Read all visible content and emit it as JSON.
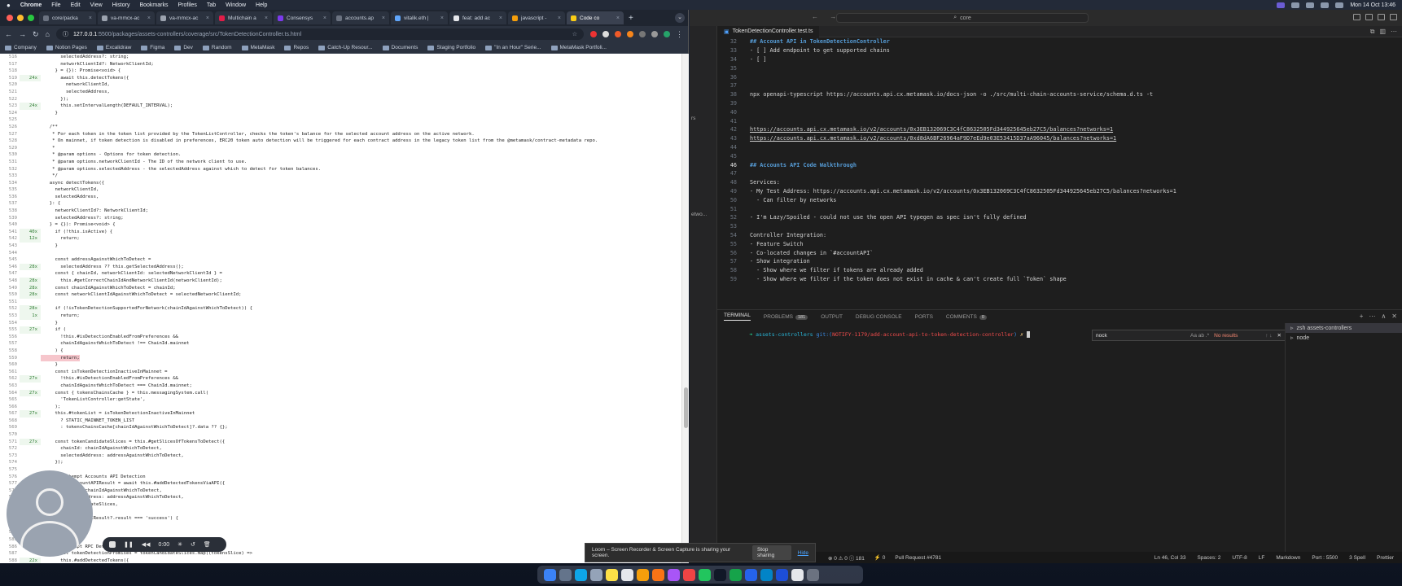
{
  "menubar": {
    "app": "Chrome",
    "items": [
      "File",
      "Edit",
      "View",
      "History",
      "Bookmarks",
      "Profiles",
      "Tab",
      "Window",
      "Help"
    ],
    "clock": "Mon 14 Oct 13:46"
  },
  "browser": {
    "tabs": [
      {
        "label": "core/packa",
        "color": "#6b7280"
      },
      {
        "label": "va-mmcx-ac",
        "color": "#9ca3af"
      },
      {
        "label": "va-mmcx-ac",
        "color": "#9ca3af"
      },
      {
        "label": "Multichain a",
        "color": "#e11d48"
      },
      {
        "label": "Consensys",
        "color": "#7c3aed"
      },
      {
        "label": "accounts.ap",
        "color": "#6b7280"
      },
      {
        "label": "vitalik.eth |",
        "color": "#60a5fa"
      },
      {
        "label": "feat: add ac",
        "color": "#e5e7eb"
      },
      {
        "label": "javascript -",
        "color": "#f59e0b"
      },
      {
        "label": "Code co",
        "color": "#facc15"
      }
    ],
    "new_tab": "+",
    "url_host": "127.0.0.1",
    "url_path": ":5500/packages/assets-controllers/coverage/src/TokenDetectionController.ts.html",
    "bookmarks": [
      "Company",
      "Notion Pages",
      "Excalidraw",
      "Figma",
      "Dev",
      "Random",
      "MetaMask",
      "Repos",
      "Catch-Up Resour...",
      "Documents",
      "Staging Portfolio",
      "\"In an Hour\" Serie...",
      "MetaMask Portfoli..."
    ]
  },
  "coverage": {
    "lines": [
      {
        "n": "516",
        "h": "",
        "t": "      selectedAddress?: string;"
      },
      {
        "n": "517",
        "h": "",
        "t": "      networkClientId?: NetworkClientId;"
      },
      {
        "n": "518",
        "h": "",
        "t": "    } = {}): Promise<void> {"
      },
      {
        "n": "519",
        "h": "24x",
        "t": "      await this.detectTokens({"
      },
      {
        "n": "520",
        "h": "",
        "t": "        networkClientId,"
      },
      {
        "n": "521",
        "h": "",
        "t": "        selectedAddress,"
      },
      {
        "n": "522",
        "h": "",
        "t": "      });"
      },
      {
        "n": "523",
        "h": "24x",
        "t": "      this.setIntervalLength(DEFAULT_INTERVAL);"
      },
      {
        "n": "524",
        "h": "",
        "t": "    }"
      },
      {
        "n": "525",
        "h": "",
        "t": ""
      },
      {
        "n": "526",
        "h": "",
        "t": "  /**"
      },
      {
        "n": "527",
        "h": "",
        "t": "   * For each token in the token list provided by the TokenListController, checks the token's balance for the selected account address on the active network."
      },
      {
        "n": "528",
        "h": "",
        "t": "   * On mainnet, if token detection is disabled in preferences, ERC20 token auto detection will be triggered for each contract address in the legacy token list from the @metamask/contract-metadata repo."
      },
      {
        "n": "529",
        "h": "",
        "t": "   *"
      },
      {
        "n": "530",
        "h": "",
        "t": "   * @param options - Options for token detection."
      },
      {
        "n": "531",
        "h": "",
        "t": "   * @param options.networkClientId - The ID of the network client to use."
      },
      {
        "n": "532",
        "h": "",
        "t": "   * @param options.selectedAddress - the selectedAddress against which to detect for token balances."
      },
      {
        "n": "533",
        "h": "",
        "t": "   */"
      },
      {
        "n": "534",
        "h": "",
        "t": "  async detectTokens({"
      },
      {
        "n": "535",
        "h": "",
        "t": "    networkClientId,"
      },
      {
        "n": "536",
        "h": "",
        "t": "    selectedAddress,"
      },
      {
        "n": "537",
        "h": "",
        "t": "  }: {"
      },
      {
        "n": "538",
        "h": "",
        "t": "    networkClientId?: NetworkClientId;"
      },
      {
        "n": "539",
        "h": "",
        "t": "    selectedAddress?: string;"
      },
      {
        "n": "540",
        "h": "",
        "t": "  } = {}): Promise<void> {"
      },
      {
        "n": "541",
        "h": "40x",
        "t": "    if (!this.isActive) {"
      },
      {
        "n": "542",
        "h": "12x",
        "t": "      return;"
      },
      {
        "n": "543",
        "h": "",
        "t": "    }"
      },
      {
        "n": "544",
        "h": "",
        "t": ""
      },
      {
        "n": "545",
        "h": "",
        "t": "    const addressAgainstWhichToDetect ="
      },
      {
        "n": "546",
        "h": "28x",
        "t": "      selectedAddress ?? this.getSelectedAddress();"
      },
      {
        "n": "547",
        "h": "",
        "t": "    const { chainId, networkClientId: selectedNetworkClientId } ="
      },
      {
        "n": "548",
        "h": "28x",
        "t": "      this.#getCorrectChainIdAndNetworkClientId(networkClientId);"
      },
      {
        "n": "549",
        "h": "28x",
        "t": "    const chainIdAgainstWhichToDetect = chainId;"
      },
      {
        "n": "550",
        "h": "28x",
        "t": "    const networkClientIdAgainstWhichToDetect = selectedNetworkClientId;"
      },
      {
        "n": "551",
        "h": "",
        "t": ""
      },
      {
        "n": "552",
        "h": "28x",
        "t": "    if (!isTokenDetectionSupportedForNetwork(chainIdAgainstWhichToDetect)) {"
      },
      {
        "n": "553",
        "h": "1x",
        "t": "      return;"
      },
      {
        "n": "554",
        "h": "",
        "t": "    }"
      },
      {
        "n": "555",
        "h": "27x",
        "t": "    if ("
      },
      {
        "n": "556",
        "h": "",
        "t": "      !this.#isDetectionEnabledFromPreferences &&"
      },
      {
        "n": "557",
        "h": "",
        "t": "      chainIdAgainstWhichToDetect !== ChainId.mainnet"
      },
      {
        "n": "558",
        "h": "",
        "t": "    ) {"
      },
      {
        "n": "559",
        "h": "",
        "t": "      return;",
        "uncovered": true
      },
      {
        "n": "560",
        "h": "",
        "t": "    }"
      },
      {
        "n": "561",
        "h": "",
        "t": "    const isTokenDetectionInactiveInMainnet ="
      },
      {
        "n": "562",
        "h": "27x",
        "t": "      !this.#isDetectionEnabledFromPreferences &&"
      },
      {
        "n": "563",
        "h": "",
        "t": "      chainIdAgainstWhichToDetect === ChainId.mainnet;"
      },
      {
        "n": "564",
        "h": "27x",
        "t": "    const { tokensChainsCache } = this.messagingSystem.call("
      },
      {
        "n": "565",
        "h": "",
        "t": "      'TokenListController:getState',"
      },
      {
        "n": "566",
        "h": "",
        "t": "    );"
      },
      {
        "n": "567",
        "h": "27x",
        "t": "    this.#tokenList = isTokenDetectionInactiveInMainnet"
      },
      {
        "n": "568",
        "h": "",
        "t": "      ? STATIC_MAINNET_TOKEN_LIST"
      },
      {
        "n": "569",
        "h": "",
        "t": "      : tokensChainsCache[chainIdAgainstWhichToDetect]?.data ?? {};"
      },
      {
        "n": "570",
        "h": "",
        "t": ""
      },
      {
        "n": "571",
        "h": "27x",
        "t": "    const tokenCandidateSlices = this.#getSlicesOfTokensToDetect({"
      },
      {
        "n": "572",
        "h": "",
        "t": "      chainId: chainIdAgainstWhichToDetect,"
      },
      {
        "n": "573",
        "h": "",
        "t": "      selectedAddress: addressAgainstWhichToDetect,"
      },
      {
        "n": "574",
        "h": "",
        "t": "    });"
      },
      {
        "n": "575",
        "h": "",
        "t": ""
      },
      {
        "n": "576",
        "h": "",
        "t": "    // Attempt Accounts API Detection"
      },
      {
        "n": "577",
        "h": "",
        "t": "    const accountAPIResult = await this.#addDetectedTokensViaAPI({"
      },
      {
        "n": "578",
        "h": "",
        "t": "      chainId: chainIdAgainstWhichToDetect,"
      },
      {
        "n": "579",
        "h": "",
        "t": "      selectedAddress: addressAgainstWhichToDetect,"
      },
      {
        "n": "580",
        "h": "",
        "t": "      tokenCandidateSlices,"
      },
      {
        "n": "581",
        "h": "",
        "t": "    });"
      },
      {
        "n": "582",
        "h": "",
        "t": "    if (accountAPIResult?.result === 'success') {"
      },
      {
        "n": "583",
        "h": "",
        "t": "      return;"
      },
      {
        "n": "584",
        "h": "",
        "t": "    }"
      },
      {
        "n": "585",
        "h": "",
        "t": ""
      },
      {
        "n": "586",
        "h": "",
        "t": "    // Attempt RPC Detection"
      },
      {
        "n": "587",
        "h": "",
        "t": "    const tokenDetectionPromises = tokenCandidateSlices.map((tokensSlice) =>"
      },
      {
        "n": "588",
        "h": "22x",
        "t": "      this.#addDetectedTokens({"
      }
    ]
  },
  "loom": {
    "time": "0:00",
    "notice": "Loom – Screen Recorder & Screen Capture is sharing your screen.",
    "stop_label": "Stop sharing",
    "hide_label": "Hide"
  },
  "vscode": {
    "search_text": "core",
    "tab_label": "TokenDetectionController.test.ts",
    "editor_lines": [
      {
        "n": "32",
        "t": "## Account API in TokenDetectionController",
        "k": "h"
      },
      {
        "n": "33",
        "t": "- [ ] Add endpoint to get supported chains",
        "k": ""
      },
      {
        "n": "34",
        "t": "- [ ]",
        "k": ""
      },
      {
        "n": "35",
        "t": "",
        "k": ""
      },
      {
        "n": "36",
        "t": "",
        "k": ""
      },
      {
        "n": "37",
        "t": "",
        "k": ""
      },
      {
        "n": "38",
        "t": "npx openapi-typescript https://accounts.api.cx.metamask.io/docs-json -o ./src/multi-chain-accounts-service/schema.d.ts -t",
        "k": ""
      },
      {
        "n": "39",
        "t": "",
        "k": ""
      },
      {
        "n": "40",
        "t": "",
        "k": ""
      },
      {
        "n": "41",
        "t": "",
        "k": ""
      },
      {
        "n": "42",
        "t": "https://accounts.api.cx.metamask.io/v2/accounts/0x3EB132069C3C4fC8632505Fd344925645eb27C5/balances?networks=1",
        "k": "url"
      },
      {
        "n": "43",
        "t": "https://accounts.api.cx.metamask.io/v2/accounts/0xd8dA6BF26964aF9D7eEd9e03E53415D37aA96045/balances?networks=1",
        "k": "url"
      },
      {
        "n": "44",
        "t": "",
        "k": ""
      },
      {
        "n": "45",
        "t": "",
        "k": ""
      },
      {
        "n": "46",
        "t": "## Accounts API Code Walkthrough",
        "k": "h",
        "cur": true
      },
      {
        "n": "47",
        "t": "",
        "k": ""
      },
      {
        "n": "48",
        "t": "Services:",
        "k": ""
      },
      {
        "n": "49",
        "t": "- My Test Address: https://accounts.api.cx.metamask.io/v2/accounts/0x3EB132069C3C4fC8632505Fd344925645eb27C5/balances?networks=1",
        "k": ""
      },
      {
        "n": "50",
        "t": "  - Can filter by networks",
        "k": ""
      },
      {
        "n": "51",
        "t": "",
        "k": ""
      },
      {
        "n": "52",
        "t": "- I'm Lazy/Spoiled - could not use the open API typegen as spec isn't fully defined",
        "k": ""
      },
      {
        "n": "53",
        "t": "",
        "k": ""
      },
      {
        "n": "54",
        "t": "Controller Integration:",
        "k": ""
      },
      {
        "n": "55",
        "t": "- Feature Switch",
        "k": ""
      },
      {
        "n": "56",
        "t": "- Co-located changes in `#accountAPI`",
        "k": ""
      },
      {
        "n": "57",
        "t": "- Show integration",
        "k": ""
      },
      {
        "n": "58",
        "t": "  - Show where we filter if tokens are already added",
        "k": ""
      },
      {
        "n": "59",
        "t": "  - Show where we filter if the token does not exist in cache & can't create full `Token` shape",
        "k": ""
      }
    ],
    "panel_tabs": [
      {
        "label": "TERMINAL",
        "badge": ""
      },
      {
        "label": "PROBLEMS",
        "badge": "181"
      },
      {
        "label": "OUTPUT",
        "badge": ""
      },
      {
        "label": "DEBUG CONSOLE",
        "badge": ""
      },
      {
        "label": "PORTS",
        "badge": ""
      },
      {
        "label": "COMMENTS",
        "badge": "0"
      }
    ],
    "terminal": {
      "dir": "assets-controllers",
      "git": "git:(",
      "branch": "NOTIFY-1179/add-account-api-to-token-detection-controller",
      "close": ")",
      "prompt": "✗"
    },
    "find": {
      "value": "nock",
      "result": "No results",
      "opts": "Aa ab .*"
    },
    "terminals": [
      "zsh  assets-controllers",
      "node"
    ],
    "status": {
      "problems": "⊗ 0 ⚠ 0 ⓘ 181",
      "ports": "⚡ 0",
      "pr": "Pull Request #4781",
      "pos": "Ln 46, Col 33",
      "spaces": "Spaces: 2",
      "enc": "UTF-8",
      "eol": "LF",
      "lang": "Markdown",
      "port": "Port : 5500",
      "spell": "3 Spell",
      "fmt": "Prettier"
    }
  }
}
